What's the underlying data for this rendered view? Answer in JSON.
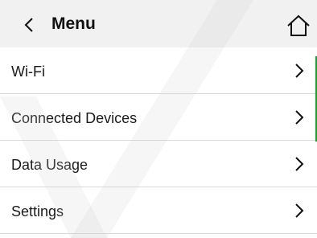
{
  "header": {
    "title": "Menu",
    "back_icon": "chevron-left-icon",
    "home_icon": "home-icon",
    "background": "#f1f1f1"
  },
  "menu": {
    "items": [
      {
        "label": "Wi-Fi",
        "icon": "chevron-right-icon"
      },
      {
        "label": "Connected Devices",
        "icon": "chevron-right-icon"
      },
      {
        "label": "Data Usage",
        "icon": "chevron-right-icon"
      },
      {
        "label": "Settings",
        "icon": "chevron-right-icon"
      }
    ]
  },
  "colors": {
    "accent": "#1aa22e",
    "divider": "#d9d9d9",
    "text": "#1a1a1a"
  }
}
